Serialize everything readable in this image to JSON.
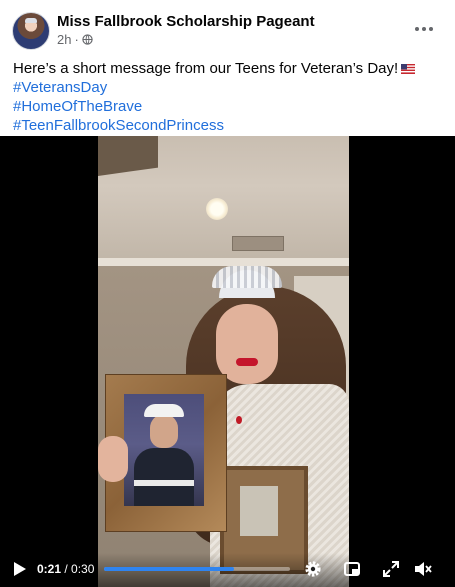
{
  "post": {
    "page_name": "Miss Fallbrook Scholarship Pageant",
    "time_ago": "2h",
    "separator": "·",
    "audience_icon": "globe-icon",
    "more_icon": "more-options-icon",
    "text_line": "Here’s a short message from our Teens for Veteran’s Day!",
    "flag_icon": "us-flag-icon",
    "hashtags": [
      "#VeteransDay",
      "#HomeOfTheBrave",
      "#TeenFallbrookSecondPrincess"
    ]
  },
  "video": {
    "current_time": "0:21",
    "time_separator": " / ",
    "duration": "0:30",
    "progress_fraction": 0.7,
    "accent_color": "#2f84f0",
    "icons": [
      "play-icon",
      "settings-icon",
      "picture-in-picture-icon",
      "fullscreen-icon",
      "muted-speaker-icon"
    ]
  },
  "colors": {
    "hashtag": "#216fdb",
    "secondary_text": "#65676b"
  }
}
